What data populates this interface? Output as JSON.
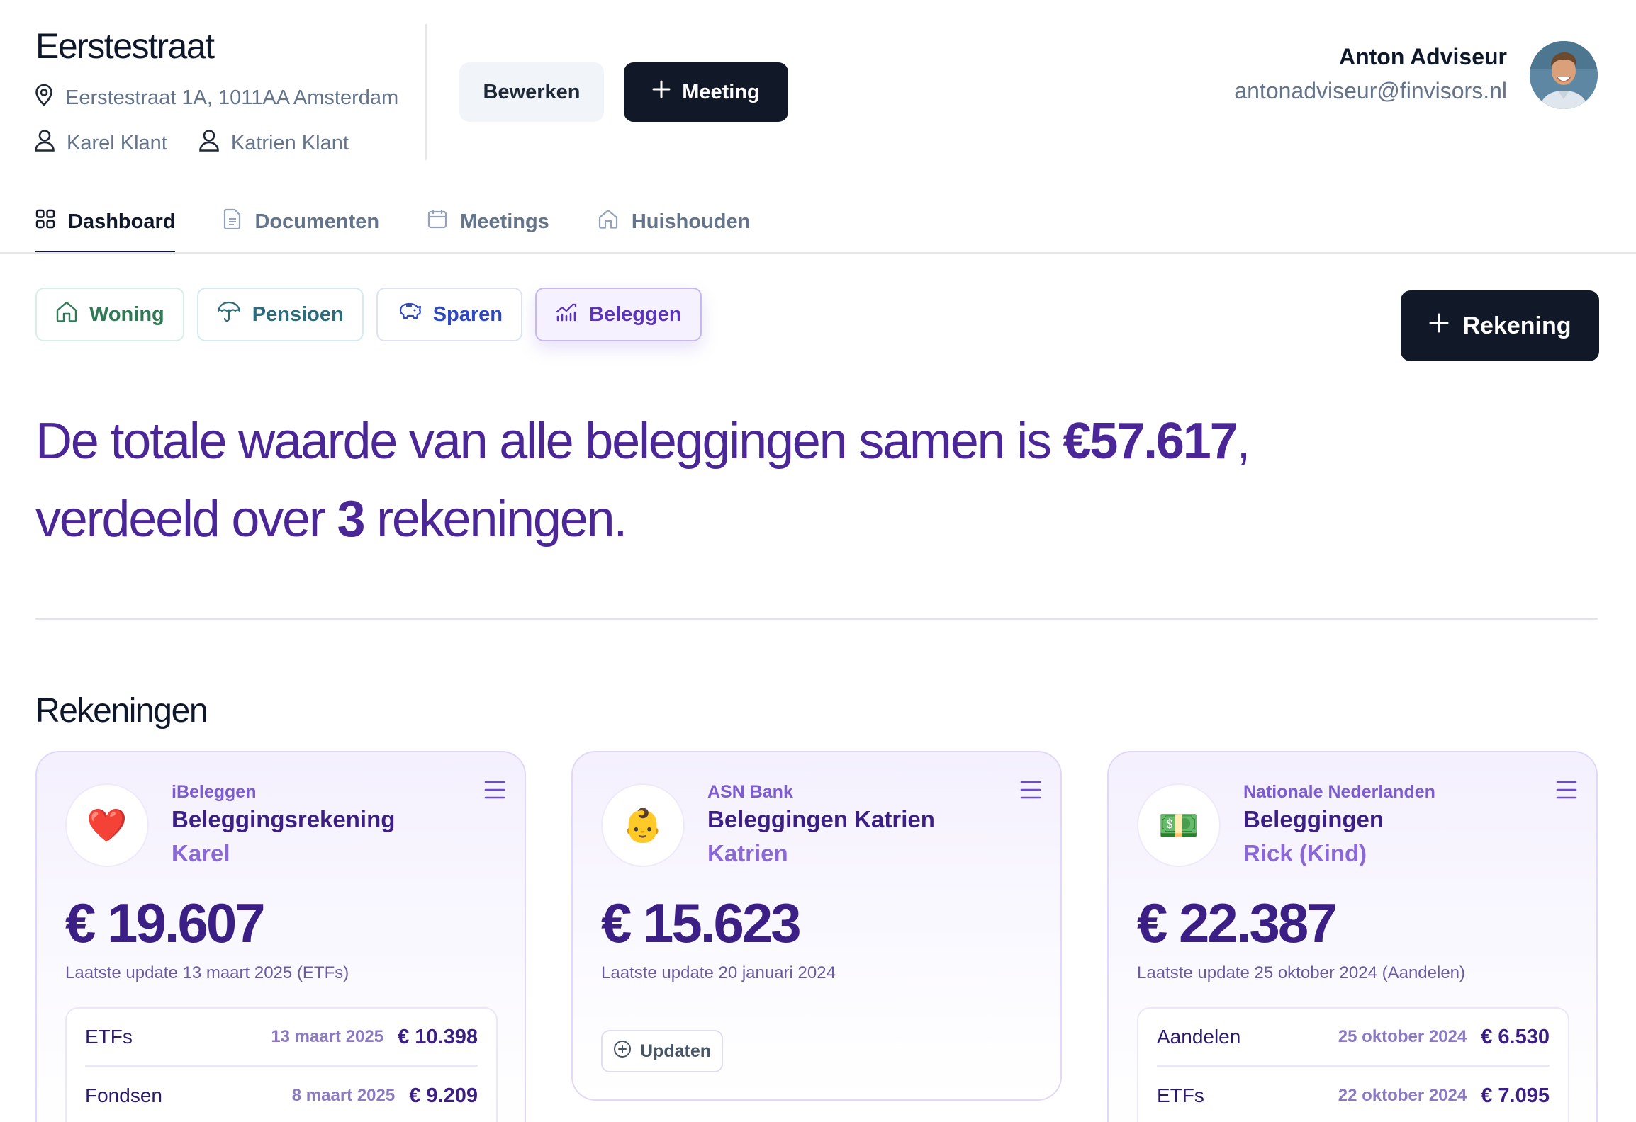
{
  "header": {
    "client_title": "Eerstestraat",
    "address": "Eerstestraat 1A, 1011AA Amsterdam",
    "persons": [
      "Karel Klant",
      "Katrien Klant"
    ],
    "edit_label": "Bewerken",
    "meeting_label": "Meeting",
    "user": {
      "name": "Anton Adviseur",
      "email": "antonadviseur@finvisors.nl"
    }
  },
  "tabs": [
    {
      "label": "Dashboard",
      "icon": "grid-icon",
      "active": true
    },
    {
      "label": "Documenten",
      "icon": "document-icon",
      "active": false
    },
    {
      "label": "Meetings",
      "icon": "calendar-icon",
      "active": false
    },
    {
      "label": "Huishouden",
      "icon": "home-icon",
      "active": false
    }
  ],
  "categories": [
    {
      "label": "Woning",
      "icon": "house-icon",
      "color": "#2f7a55"
    },
    {
      "label": "Pensioen",
      "icon": "umbrella-icon",
      "color": "#2c6b7a"
    },
    {
      "label": "Sparen",
      "icon": "piggy-bank-icon",
      "color": "#2f47c0"
    },
    {
      "label": "Beleggen",
      "icon": "chart-icon",
      "color": "#5b34b8",
      "active": true
    }
  ],
  "add_account_label": "Rekening",
  "summary": {
    "part1": "De totale waarde van alle beleggingen samen is ",
    "total": "€57.617",
    "part2": ", verdeeld over ",
    "count": "3",
    "part3": " rekeningen."
  },
  "accounts_title": "Rekeningen",
  "accounts": [
    {
      "logo": "❤️",
      "provider": "iBeleggen",
      "name": "Beleggingsrekening",
      "owner": "Karel",
      "amount": "€ 19.607",
      "updated": "Laatste update 13 maart 2025 (ETFs)",
      "items": [
        {
          "label": "ETFs",
          "date": "13 maart 2025",
          "value": "€ 10.398"
        },
        {
          "label": "Fondsen",
          "date": "8 maart 2025",
          "value": "€ 9.209"
        }
      ]
    },
    {
      "logo": "👶",
      "provider": "ASN Bank",
      "name": "Beleggingen Katrien",
      "owner": "Katrien",
      "amount": "€ 15.623",
      "updated": "Laatste update 20 januari 2024",
      "update_button": "Updaten"
    },
    {
      "logo": "💵",
      "provider": "Nationale Nederlanden",
      "name": "Beleggingen",
      "owner": "Rick (Kind)",
      "amount": "€ 22.387",
      "updated": "Laatste update 25 oktober 2024 (Aandelen)",
      "items": [
        {
          "label": "Aandelen",
          "date": "25 oktober 2024",
          "value": "€ 6.530"
        },
        {
          "label": "ETFs",
          "date": "22 oktober 2024",
          "value": "€ 7.095"
        }
      ]
    }
  ],
  "colors": {
    "primary_dark": "#111827",
    "accent_purple": "#4a2697",
    "muted": "#64748b"
  }
}
